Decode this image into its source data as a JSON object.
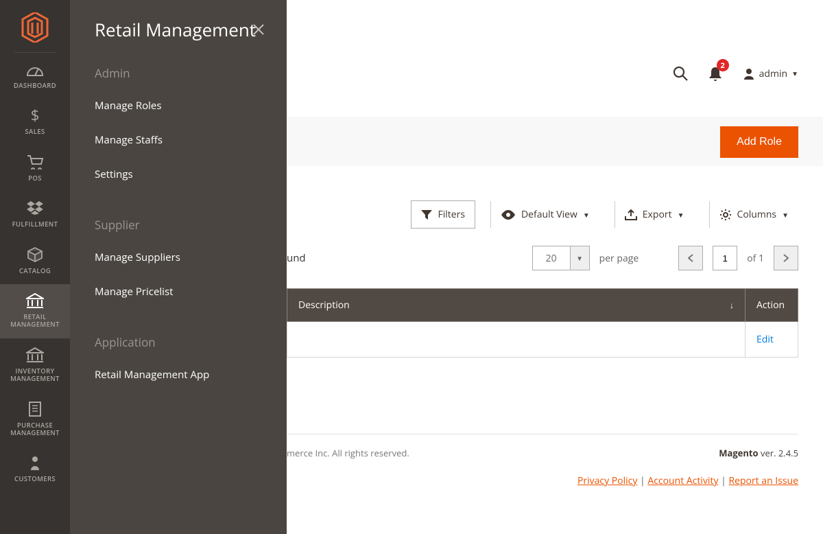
{
  "sidebar": {
    "items": [
      {
        "label": "DASHBOARD"
      },
      {
        "label": "SALES"
      },
      {
        "label": "POS"
      },
      {
        "label": "FULFILLMENT"
      },
      {
        "label": "CATALOG"
      },
      {
        "label": "RETAIL\nMANAGEMENT"
      },
      {
        "label": "INVENTORY\nMANAGEMENT"
      },
      {
        "label": "PURCHASE\nMANAGEMENT"
      },
      {
        "label": "CUSTOMERS"
      }
    ]
  },
  "flyout": {
    "title": "Retail Management",
    "sections": [
      {
        "title": "Admin",
        "links": [
          "Manage Roles",
          "Manage Staffs",
          "Settings"
        ]
      },
      {
        "title": "Supplier",
        "links": [
          "Manage Suppliers",
          "Manage Pricelist"
        ]
      },
      {
        "title": "Application",
        "links": [
          "Retail Management App"
        ]
      }
    ]
  },
  "header": {
    "notification_count": "2",
    "user_label": "admin"
  },
  "page": {
    "add_role_label": "Add Role"
  },
  "toolbar": {
    "filters": "Filters",
    "default_view": "Default View",
    "export": "Export",
    "columns": "Columns"
  },
  "pager": {
    "found_suffix": "und",
    "page_size": "20",
    "per_page": "per page",
    "current": "1",
    "total_text": "of 1"
  },
  "table": {
    "col_description": "Description",
    "col_action": "Action",
    "rows": [
      {
        "description": "",
        "action": "Edit"
      }
    ]
  },
  "footer": {
    "copyright_mid": "merce Inc. All rights reserved.",
    "version_prefix": "Magento",
    "version": " ver. 2.4.5",
    "privacy": "Privacy Policy",
    "activity": "Account Activity",
    "report": "Report an Issue"
  }
}
